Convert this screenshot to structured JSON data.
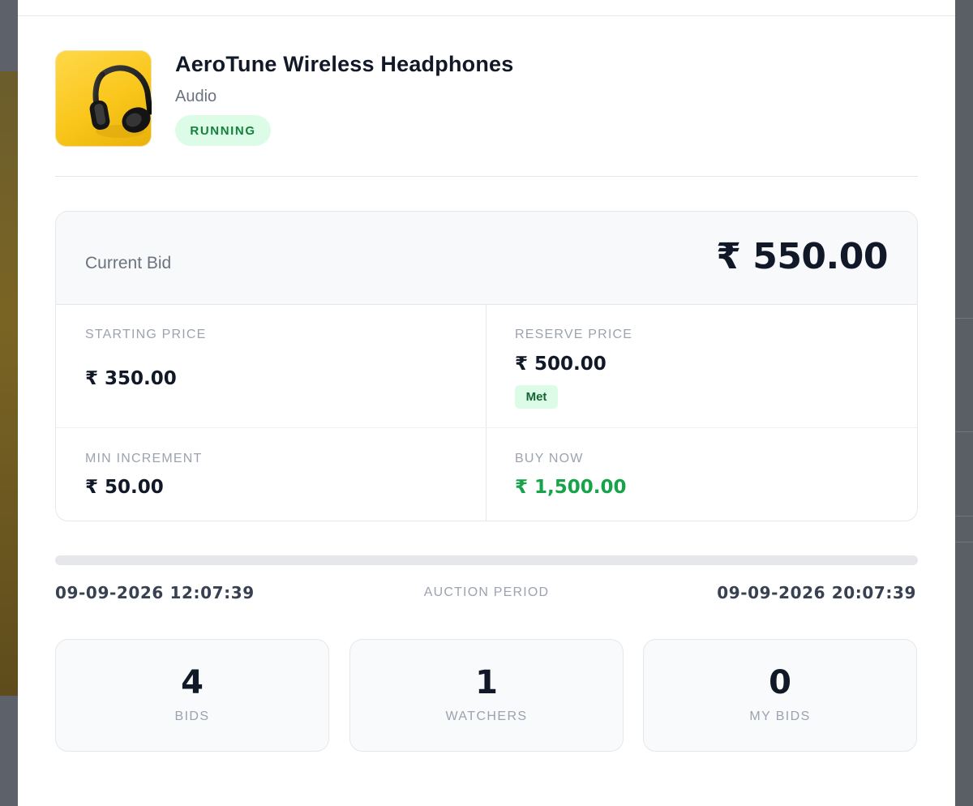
{
  "item": {
    "title": "AeroTune Wireless Headphones",
    "category": "Audio",
    "status": "RUNNING",
    "image_icon": "headphones-icon"
  },
  "bid": {
    "current_label": "Current Bid",
    "current_value": "₹ 550.00",
    "starting_label": "STARTING PRICE",
    "starting_value": "₹ 350.00",
    "reserve_label": "RESERVE PRICE",
    "reserve_value": "₹ 500.00",
    "reserve_status": "Met",
    "increment_label": "MIN INCREMENT",
    "increment_value": "₹ 50.00",
    "buynow_label": "BUY NOW",
    "buynow_value": "₹ 1,500.00"
  },
  "period": {
    "start": "09-09-2026 12:07:39",
    "label": "AUCTION PERIOD",
    "end": "09-09-2026 20:07:39",
    "progress": 0
  },
  "stats": [
    {
      "value": "4",
      "label": "BIDS"
    },
    {
      "value": "1",
      "label": "WATCHERS"
    },
    {
      "value": "0",
      "label": "MY BIDS"
    }
  ],
  "colors": {
    "status_bg": "#dcfce7",
    "status_text": "#15803d",
    "buy_now": "#16a34a",
    "thumb_yellow": "#f9c61b"
  }
}
